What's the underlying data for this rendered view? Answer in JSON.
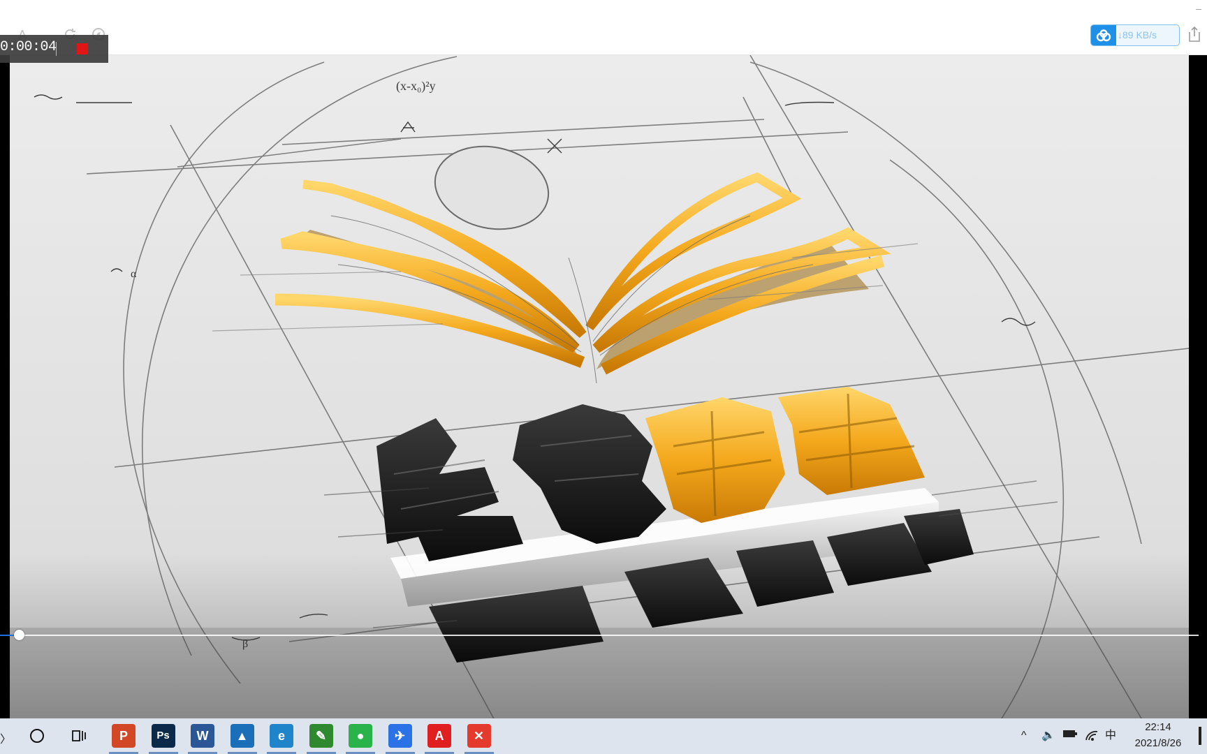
{
  "window": {
    "font_icon": "A",
    "refresh_icon": "refresh-icon",
    "compass_icon": "compass-icon",
    "minimize_label": "–"
  },
  "download_widget": {
    "icon": "baidu-cloud-icon",
    "speed": "↓89 KB/s",
    "accent": "#1e90e8"
  },
  "recorder": {
    "elapsed": "0:00:04",
    "stop_color": "#e01616"
  },
  "video": {
    "progress_fraction": 0.015,
    "progress_color": "#1f6fe0",
    "sketch_annotations": [
      "(x-x₀)²y",
      "α",
      "β"
    ],
    "logo_colors": {
      "gold": "#f4a81c",
      "dark": "#161616"
    }
  },
  "taskbar": {
    "search_icon": "cortana-circle-icon",
    "taskview_icon": "task-view-icon",
    "apps": [
      {
        "name": "powerpoint",
        "glyph": "P",
        "color": "#d24726"
      },
      {
        "name": "photoshop",
        "glyph": "Ps",
        "color": "#0b2a4a"
      },
      {
        "name": "word",
        "glyph": "W",
        "color": "#2b5797"
      },
      {
        "name": "photos",
        "glyph": "▲",
        "color": "#1b6fb8"
      },
      {
        "name": "edge",
        "glyph": "e",
        "color": "#1f84c9"
      },
      {
        "name": "app-green",
        "glyph": "✎",
        "color": "#2f8a2f"
      },
      {
        "name": "wechat",
        "glyph": "●",
        "color": "#29b34a"
      },
      {
        "name": "feishu",
        "glyph": "✈",
        "color": "#2a72e6"
      },
      {
        "name": "acrobat",
        "glyph": "A",
        "color": "#e02020"
      },
      {
        "name": "wps",
        "glyph": "✕",
        "color": "#e53a2e"
      }
    ],
    "tray": {
      "chevron": "^",
      "volume": "🔈",
      "battery": "▭",
      "wifi": "wifi-icon",
      "ime": "中"
    },
    "time": "22:14",
    "date": "2021/8/26"
  }
}
